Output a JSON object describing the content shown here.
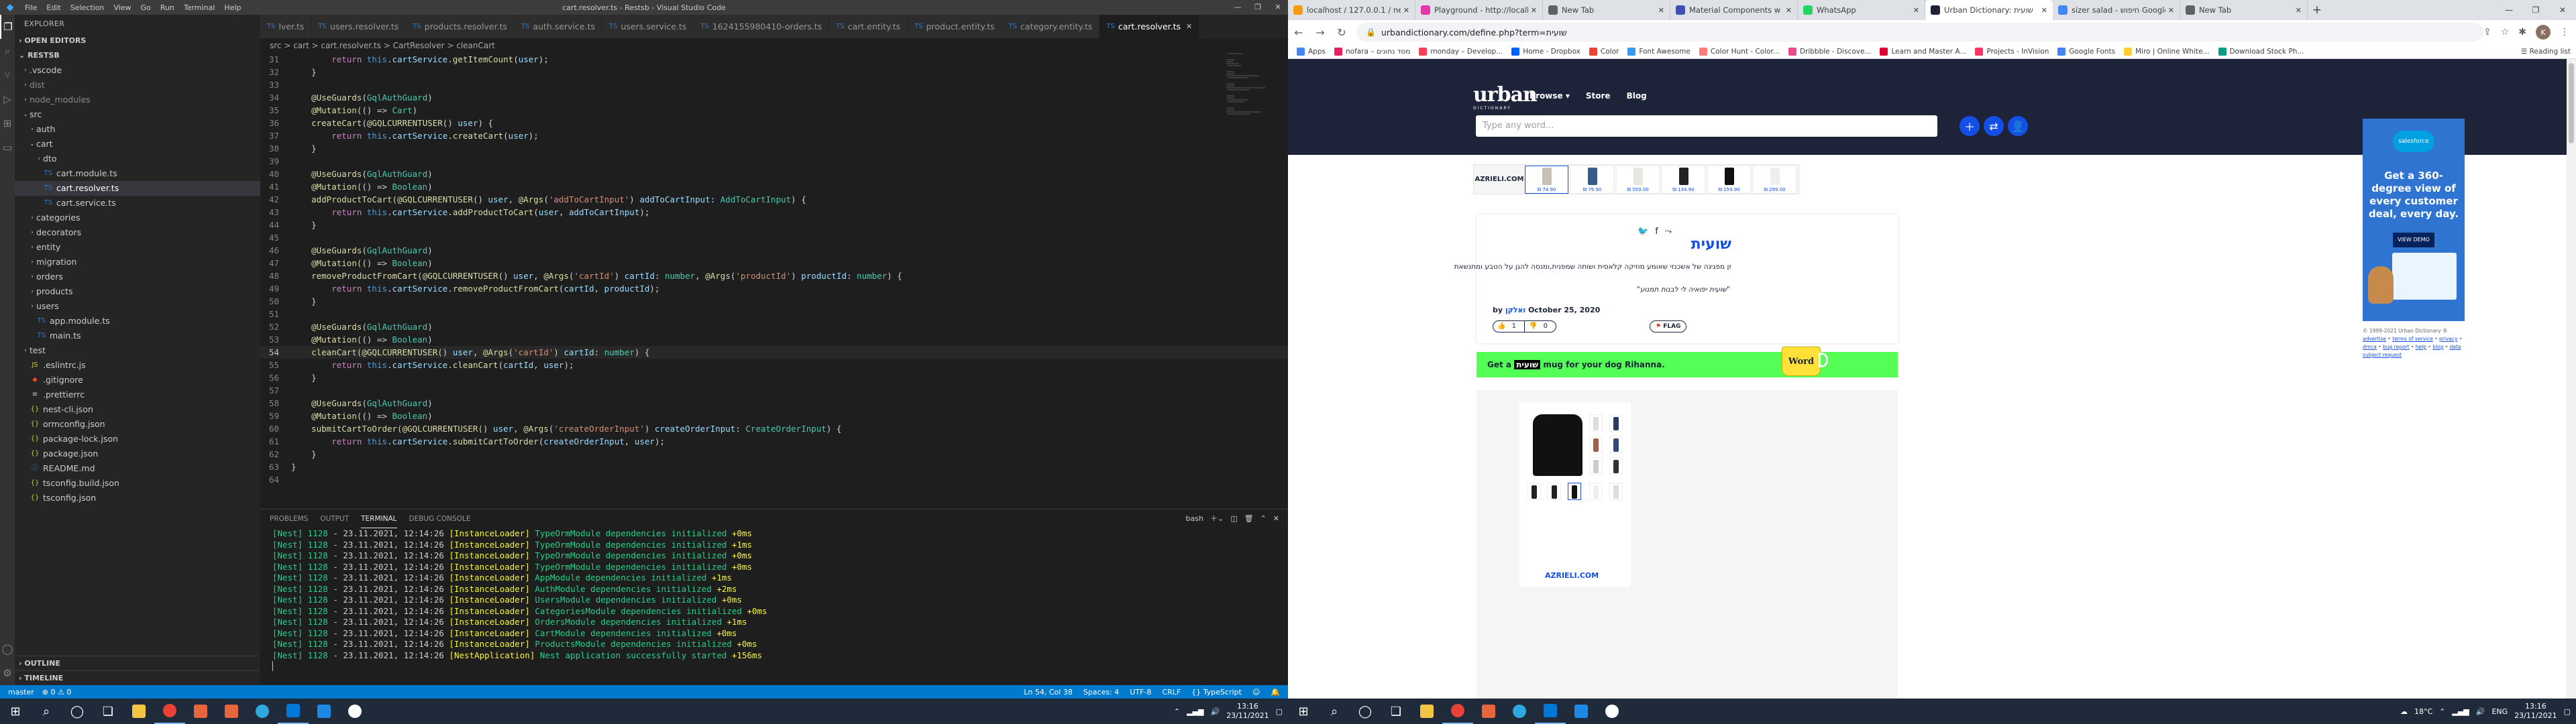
{
  "vscode": {
    "window_title": "cart.resolver.ts - Restsb - Visual Studio Code",
    "menu": [
      "File",
      "Edit",
      "Selection",
      "View",
      "Go",
      "Run",
      "Terminal",
      "Help"
    ],
    "explorer_title": "EXPLORER",
    "open_editors": "OPEN EDITORS",
    "project": "RESTSB",
    "tree": [
      {
        "label": ".vscode",
        "kind": "folder",
        "depth": 1
      },
      {
        "label": "dist",
        "kind": "folder",
        "depth": 1
      },
      {
        "label": "node_modules",
        "kind": "folder",
        "depth": 1
      },
      {
        "label": "src",
        "kind": "folder-open",
        "depth": 1
      },
      {
        "label": "auth",
        "kind": "folder",
        "depth": 2
      },
      {
        "label": "cart",
        "kind": "folder-open",
        "depth": 2
      },
      {
        "label": "dto",
        "kind": "folder",
        "depth": 3
      },
      {
        "label": "cart.module.ts",
        "kind": "ts",
        "depth": 3
      },
      {
        "label": "cart.resolver.ts",
        "kind": "ts",
        "depth": 3,
        "selected": true
      },
      {
        "label": "cart.service.ts",
        "kind": "ts",
        "depth": 3
      },
      {
        "label": "categories",
        "kind": "folder",
        "depth": 2
      },
      {
        "label": "decorators",
        "kind": "folder",
        "depth": 2
      },
      {
        "label": "entity",
        "kind": "folder",
        "depth": 2
      },
      {
        "label": "migration",
        "kind": "folder",
        "depth": 2
      },
      {
        "label": "orders",
        "kind": "folder",
        "depth": 2
      },
      {
        "label": "products",
        "kind": "folder",
        "depth": 2
      },
      {
        "label": "users",
        "kind": "folder",
        "depth": 2
      },
      {
        "label": "app.module.ts",
        "kind": "ts",
        "depth": 2
      },
      {
        "label": "main.ts",
        "kind": "ts",
        "depth": 2
      },
      {
        "label": "test",
        "kind": "folder",
        "depth": 1
      },
      {
        "label": ".eslintrc.js",
        "kind": "js",
        "depth": 1
      },
      {
        "label": ".gitignore",
        "kind": "git",
        "depth": 1
      },
      {
        "label": ".prettierrc",
        "kind": "cfg",
        "depth": 1
      },
      {
        "label": "nest-cli.json",
        "kind": "json",
        "depth": 1
      },
      {
        "label": "ormconfig.json",
        "kind": "json",
        "depth": 1
      },
      {
        "label": "package-lock.json",
        "kind": "json",
        "depth": 1
      },
      {
        "label": "package.json",
        "kind": "json",
        "depth": 1
      },
      {
        "label": "README.md",
        "kind": "md",
        "depth": 1
      },
      {
        "label": "tsconfig.build.json",
        "kind": "json",
        "depth": 1
      },
      {
        "label": "tsconfig.json",
        "kind": "json",
        "depth": 1
      }
    ],
    "outline": "OUTLINE",
    "timeline": "TIMELINE",
    "tabs": [
      {
        "label": "lver.ts"
      },
      {
        "label": "users.resolver.ts"
      },
      {
        "label": "products.resolver.ts"
      },
      {
        "label": "auth.service.ts"
      },
      {
        "label": "users.service.ts"
      },
      {
        "label": "1624155980410-orders.ts"
      },
      {
        "label": "cart.entity.ts"
      },
      {
        "label": "product.entity.ts"
      },
      {
        "label": "category.entity.ts"
      },
      {
        "label": "cart.resolver.ts",
        "active": true
      }
    ],
    "breadcrumb": "src > cart > cart.resolver.ts > CartResolver > cleanCart",
    "code_first_line": 31,
    "code": [
      "        return this.cartService.getItemCount(user);",
      "    }",
      "",
      "    @UseGuards(GqlAuthGuard)",
      "    @Mutation(() => Cart)",
      "    createCart(@GQLCURRENTUSER() user) {",
      "        return this.cartService.createCart(user);",
      "    }",
      "",
      "    @UseGuards(GqlAuthGuard)",
      "    @Mutation(() => Boolean)",
      "    addProductToCart(@GQLCURRENTUSER() user, @Args('addToCartInput') addToCartInput: AddToCartInput) {",
      "        return this.cartService.addProductToCart(user, addToCartInput);",
      "    }",
      "",
      "    @UseGuards(GqlAuthGuard)",
      "    @Mutation(() => Boolean)",
      "    removeProductFromCart(@GQLCURRENTUSER() user, @Args('cartId') cartId: number, @Args('productId') productId: number) {",
      "        return this.cartService.removeProductFromCart(cartId, productId);",
      "    }",
      "",
      "    @UseGuards(GqlAuthGuard)",
      "    @Mutation(() => Boolean)",
      "    cleanCart(@GQLCURRENTUSER() user, @Args('cartId') cartId: number) {",
      "        return this.cartService.cleanCart(cartId, user);",
      "    }",
      "",
      "    @UseGuards(GqlAuthGuard)",
      "    @Mutation(() => Boolean)",
      "    submitCartToOrder(@GQLCURRENTUSER() user, @Args('createOrderInput') createOrderInput: CreateOrderInput) {",
      "        return this.cartService.submitCartToOrder(createOrderInput, user);",
      "    }",
      "}",
      ""
    ],
    "cursor_line": 54,
    "panel_tabs": [
      "PROBLEMS",
      "OUTPUT",
      "TERMINAL",
      "DEBUG CONSOLE"
    ],
    "active_panel": "TERMINAL",
    "terminal_shell": "bash",
    "terminal": [
      {
        "pid": "[Nest] 1128",
        "time": "- 23.11.2021, 12:14:26",
        "ctx": "[InstanceLoader]",
        "msg": "TypeOrmModule dependencies initialized",
        "ms": "+0ms"
      },
      {
        "pid": "[Nest] 1128",
        "time": "- 23.11.2021, 12:14:26",
        "ctx": "[InstanceLoader]",
        "msg": "TypeOrmModule dependencies initialized",
        "ms": "+1ms"
      },
      {
        "pid": "[Nest] 1128",
        "time": "- 23.11.2021, 12:14:26",
        "ctx": "[InstanceLoader]",
        "msg": "TypeOrmModule dependencies initialized",
        "ms": "+0ms"
      },
      {
        "pid": "[Nest] 1128",
        "time": "- 23.11.2021, 12:14:26",
        "ctx": "[InstanceLoader]",
        "msg": "TypeOrmModule dependencies initialized",
        "ms": "+0ms"
      },
      {
        "pid": "[Nest] 1128",
        "time": "- 23.11.2021, 12:14:26",
        "ctx": "[InstanceLoader]",
        "msg": "AppModule dependencies initialized",
        "ms": "+1ms"
      },
      {
        "pid": "[Nest] 1128",
        "time": "- 23.11.2021, 12:14:26",
        "ctx": "[InstanceLoader]",
        "msg": "AuthModule dependencies initialized",
        "ms": "+2ms"
      },
      {
        "pid": "[Nest] 1128",
        "time": "- 23.11.2021, 12:14:26",
        "ctx": "[InstanceLoader]",
        "msg": "UsersModule dependencies initialized",
        "ms": "+0ms"
      },
      {
        "pid": "[Nest] 1128",
        "time": "- 23.11.2021, 12:14:26",
        "ctx": "[InstanceLoader]",
        "msg": "CategoriesModule dependencies initialized",
        "ms": "+0ms"
      },
      {
        "pid": "[Nest] 1128",
        "time": "- 23.11.2021, 12:14:26",
        "ctx": "[InstanceLoader]",
        "msg": "OrdersModule dependencies initialized",
        "ms": "+1ms"
      },
      {
        "pid": "[Nest] 1128",
        "time": "- 23.11.2021, 12:14:26",
        "ctx": "[InstanceLoader]",
        "msg": "CartModule dependencies initialized",
        "ms": "+0ms"
      },
      {
        "pid": "[Nest] 1128",
        "time": "- 23.11.2021, 12:14:26",
        "ctx": "[InstanceLoader]",
        "msg": "ProductsModule dependencies initialized",
        "ms": "+0ms"
      },
      {
        "pid": "[Nest] 1128",
        "time": "- 23.11.2021, 12:14:26",
        "ctx": "[NestApplication]",
        "msg": "Nest application successfully started",
        "ms": "+156ms"
      }
    ],
    "status_left": [
      "master",
      "⊗ 0 ⚠ 0"
    ],
    "status_right": [
      "Ln 54, Col 38",
      "Spaces: 4",
      "UTF-8",
      "CRLF",
      "{} TypeScript"
    ]
  },
  "chrome": {
    "tabs": [
      {
        "label": "localhost / 127.0.0.1 / nest",
        "color": "#f89c0e"
      },
      {
        "label": "Playground - http://localh",
        "color": "#e535ab"
      },
      {
        "label": "New Tab",
        "color": "#5f6368"
      },
      {
        "label": "Material Components w",
        "color": "#3f51b5"
      },
      {
        "label": "WhatsApp",
        "color": "#25d366"
      },
      {
        "label": "Urban Dictionary: שועית",
        "color": "#1d2439",
        "active": true
      },
      {
        "label": "sizer salad - חיפוש Google",
        "color": "#4285f4"
      },
      {
        "label": "New Tab",
        "color": "#5f6368"
      }
    ],
    "url": "urbandictionary.com/define.php?term=שועית",
    "bookmarks": [
      {
        "label": "Apps",
        "color": "#4285f4"
      },
      {
        "label": "nofara – מסד נתונים",
        "color": "#e91e63"
      },
      {
        "label": "monday – Develop...",
        "color": "#ff3d57"
      },
      {
        "label": "Home - Dropbox",
        "color": "#0061ff"
      },
      {
        "label": "Color",
        "color": "#ea4335"
      },
      {
        "label": "Font Awesome",
        "color": "#339af0"
      },
      {
        "label": "Color Hunt - Color...",
        "color": "#ff7b7b"
      },
      {
        "label": "Dribbble - Discove...",
        "color": "#ea4c89"
      },
      {
        "label": "Learn and Master A...",
        "color": "#dd0031"
      },
      {
        "label": "Projects - InVision",
        "color": "#ff3366"
      },
      {
        "label": "Google Fonts",
        "color": "#4285f4"
      },
      {
        "label": "Miro | Online White...",
        "color": "#ffd02f"
      },
      {
        "label": "Download Stock Ph...",
        "color": "#05a081"
      }
    ],
    "reading_list": "Reading list",
    "avatar_letter": "K"
  },
  "urban": {
    "logo": "urban",
    "logo_sub": "DICTIONARY",
    "nav": [
      "Browse ▾",
      "Store",
      "Blog"
    ],
    "search_placeholder": "Type any word...",
    "ad_brand": "AZRIELI.COM",
    "ad_prices": [
      "₪ 74.90",
      "₪ 79.90",
      "₪ 559.00",
      "₪ 134.90",
      "₪ 159.90",
      "₪ 299.00"
    ],
    "word": "שועית",
    "meaning": "זן מפגינה של אשכנזי שאומע מוזיקה קלאסית ושותה שמפנית,ומנסה להגן על הטבע ומתנשאת",
    "example": "\"שועית יפואיה לי לבנות תמנוע\"",
    "author_prefix": "by",
    "author": "ואלקן",
    "date": "October 25, 2020",
    "votes_up": "1",
    "votes_down": "0",
    "flag": "FLAG",
    "mug_text_before": "Get a",
    "mug_word": "שועית",
    "mug_text_after": "mug for your dog Rihanna.",
    "mug_label": "Word",
    "sf_brand": "salesforce",
    "sf_headline": "Get a 360-degree view of every customer deal, every day.",
    "sf_cta": "VIEW DEMO",
    "footer_copy": "© 1999-2021 Urban Dictionary ®",
    "footer_links": [
      "advertise",
      "terms of service",
      "privacy",
      "dmca",
      "bug report",
      "help",
      "blog",
      "data subject request"
    ]
  },
  "taskbar": {
    "left_time": "13:16",
    "left_date": "23/11/2021",
    "right_time": "13:16",
    "right_date": "23/11/2021",
    "weather": "18°C",
    "lang": "ENG"
  }
}
